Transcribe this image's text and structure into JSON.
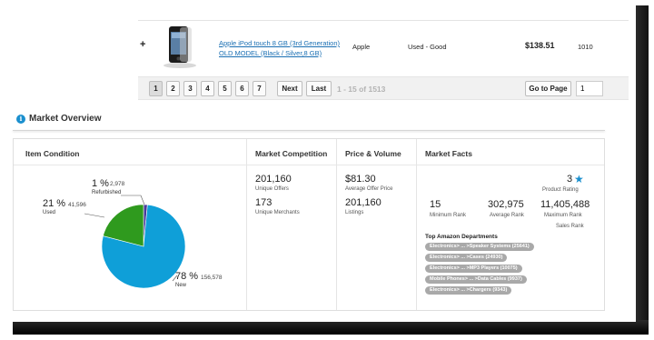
{
  "product": {
    "expand_symbol": "+",
    "title": "Apple iPod touch 8 GB (3rd Generation) OLD MODEL (Black / Silver,8 GB)",
    "brand": "Apple",
    "condition": "Used - Good",
    "price": "$138.51",
    "rank": "1010"
  },
  "pagination": {
    "pages": [
      "1",
      "2",
      "3",
      "4",
      "5",
      "6",
      "7"
    ],
    "active_page": "1",
    "next_label": "Next",
    "last_label": "Last",
    "range_text": "1 - 15 of 1513",
    "goto_label": "Go to Page",
    "goto_value": "1"
  },
  "market_overview": {
    "title": "Market Overview",
    "info_icon": "i",
    "item_condition": {
      "title": "Item Condition",
      "refurbished": {
        "pct": "1 %",
        "count": "2,978",
        "name": "Refurbished",
        "fraction": 0.015
      },
      "used": {
        "pct": "21 %",
        "count": "41,596",
        "name": "Used",
        "fraction": 0.21
      },
      "new": {
        "pct": "78 %",
        "count": "156,578",
        "name": "New",
        "fraction": 0.775
      },
      "colors": {
        "new": "#0f9fd8",
        "used": "#2f9a1e",
        "refurbished": "#4a3a9a"
      }
    },
    "competition": {
      "title": "Market Competition",
      "offers_value": "201,160",
      "offers_label": "Unique Offers",
      "merchants_value": "173",
      "merchants_label": "Unique Merchants"
    },
    "price_volume": {
      "title": "Price & Volume",
      "avg_price_value": "$81.30",
      "avg_price_label": "Average Offer Price",
      "listings_value": "201,160",
      "listings_label": "Listings"
    },
    "facts": {
      "title": "Market Facts",
      "product_rating_value": "3",
      "product_rating_label": "Product Rating",
      "min_rank_value": "15",
      "min_rank_label": "Minimum Rank",
      "avg_rank_value": "302,975",
      "avg_rank_label": "Average Rank",
      "max_rank_value": "11,405,488",
      "max_rank_label": "Maximum Rank",
      "sales_rank_label": "Sales Rank",
      "departments_title": "Top Amazon Departments",
      "departments": [
        "Electronics> ... >Speaker Systems (25641)",
        "Electronics> ... >Cases (24930)",
        "Electronics> ... >MP3 Players (10075)",
        "Mobile Phones> ... >Data Cables (9937)",
        "Electronics> ... >Chargers (9343)"
      ]
    }
  }
}
